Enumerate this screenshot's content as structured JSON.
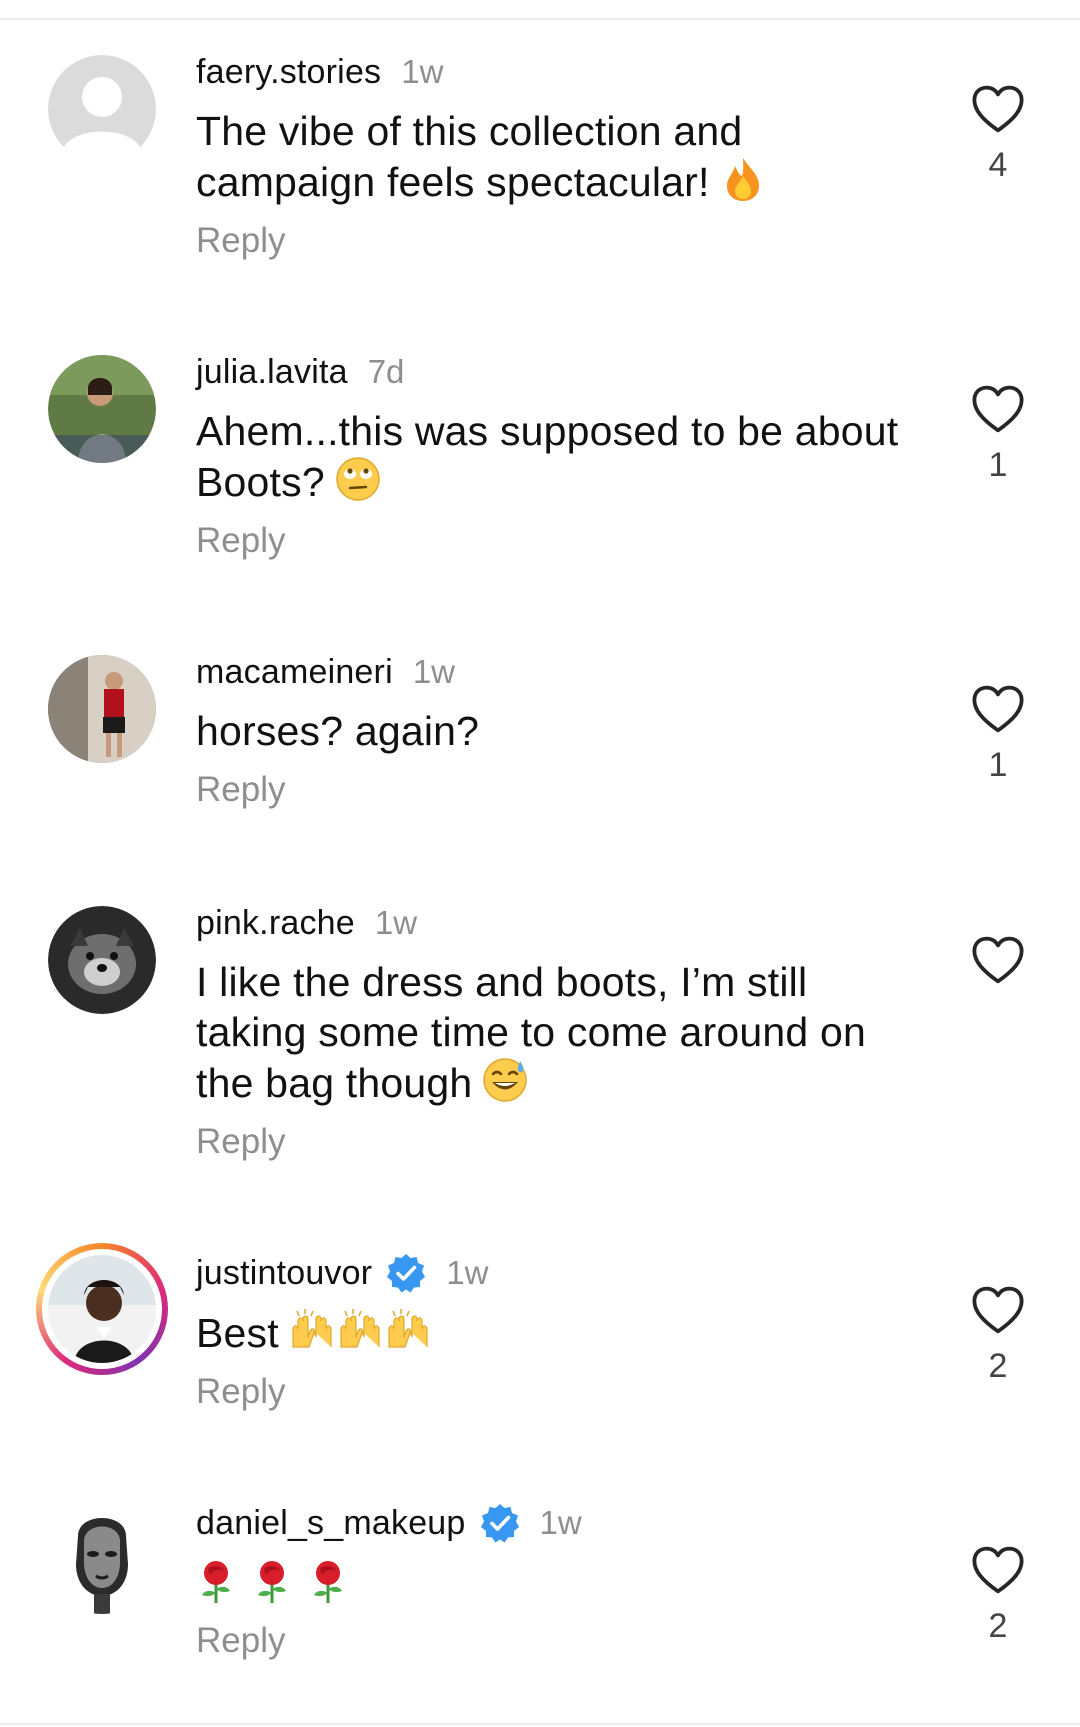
{
  "comments": [
    {
      "username": "faery.stories",
      "time": "1w",
      "text": "The vibe of this collection and campaign feels spectacular!",
      "emoji": "fire-emoji",
      "reply": "Reply",
      "likes": "4",
      "verified": false,
      "avatar": "default-avatar"
    },
    {
      "username": "julia.lavita",
      "time": "7d",
      "text": "Ahem...this was supposed to be about Boots?",
      "emoji": "eye-roll-emoji",
      "reply": "Reply",
      "likes": "1",
      "verified": false,
      "avatar": "photo-avatar"
    },
    {
      "username": "macameineri",
      "time": "1w",
      "text": "horses? again?",
      "reply": "Reply",
      "likes": "1",
      "verified": false,
      "avatar": "photo-avatar"
    },
    {
      "username": "pink.rache",
      "time": "1w",
      "text": "I like the dress and boots, I’m still taking some time to come around on the bag though",
      "emoji": "grinning-sweat-emoji",
      "reply": "Reply",
      "likes": "",
      "verified": false,
      "avatar": "dog-photo-avatar"
    },
    {
      "username": "justintouvor",
      "time": "1w",
      "text": "Best",
      "emoji": "raising-hands-emoji",
      "reply": "Reply",
      "likes": "2",
      "verified": true,
      "avatar": "story-ring-avatar"
    },
    {
      "username": "daniel_s_makeup",
      "time": "1w",
      "text": "",
      "emoji": "rose-emoji",
      "reply": "Reply",
      "likes": "2",
      "verified": true,
      "avatar": "sculpture-photo-avatar"
    }
  ],
  "colors": {
    "primary_text": "#111111",
    "secondary_text": "#8e8e8e",
    "verified_blue": "#3897f0",
    "divider": "#ededed"
  }
}
